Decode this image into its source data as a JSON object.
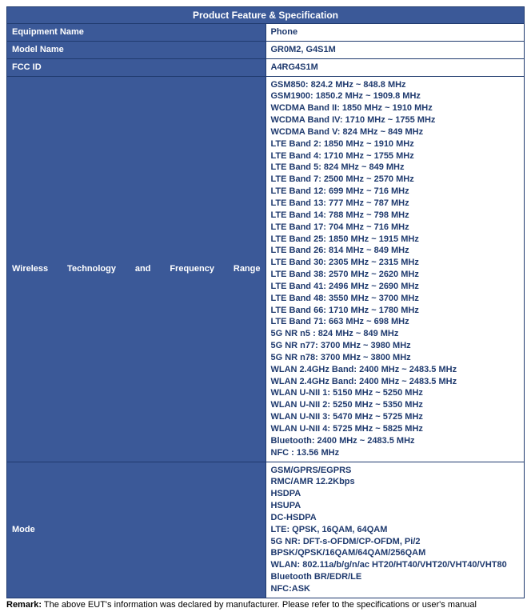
{
  "header": "Product Feature & Specification",
  "rows": {
    "equipment_name": {
      "label": "Equipment Name",
      "value": "Phone"
    },
    "model_name": {
      "label": "Model Name",
      "value": "GR0M2, G4S1M"
    },
    "fcc_id": {
      "label": "FCC ID",
      "value": "A4RG4S1M"
    },
    "wireless": {
      "label": "Wireless Technology and Frequency Range",
      "lines": [
        "GSM850: 824.2 MHz ~ 848.8 MHz",
        "GSM1900: 1850.2 MHz ~ 1909.8 MHz",
        "WCDMA Band II: 1850 MHz ~ 1910 MHz",
        "WCDMA Band IV: 1710 MHz ~ 1755 MHz",
        "WCDMA Band V: 824 MHz ~ 849 MHz",
        "LTE Band 2: 1850 MHz ~ 1910 MHz",
        "LTE Band 4: 1710 MHz ~ 1755 MHz",
        "LTE Band 5: 824 MHz ~ 849 MHz",
        "LTE Band 7: 2500 MHz ~ 2570 MHz",
        "LTE Band 12: 699 MHz ~ 716 MHz",
        "LTE Band 13: 777 MHz ~ 787 MHz",
        "LTE Band 14: 788 MHz ~ 798 MHz",
        "LTE Band 17: 704 MHz ~ 716 MHz",
        "LTE Band 25: 1850 MHz ~ 1915 MHz",
        "LTE Band 26: 814 MHz ~ 849 MHz",
        "LTE Band 30: 2305 MHz ~ 2315 MHz",
        "LTE Band 38: 2570 MHz ~ 2620 MHz",
        "LTE Band 41: 2496 MHz ~ 2690 MHz",
        "LTE Band 48: 3550 MHz ~ 3700 MHz",
        "LTE Band 66: 1710 MHz ~ 1780 MHz",
        "LTE Band 71: 663 MHz ~ 698 MHz",
        "5G NR n5 : 824 MHz ~ 849 MHz",
        "5G NR n77: 3700 MHz ~ 3980 MHz",
        "5G NR n78: 3700 MHz ~ 3800 MHz",
        "WLAN 2.4GHz Band: 2400 MHz ~ 2483.5 MHz",
        "WLAN 2.4GHz Band: 2400 MHz ~ 2483.5 MHz",
        "WLAN U-NII 1: 5150 MHz ~ 5250 MHz",
        "WLAN U-NII 2: 5250 MHz ~ 5350 MHz",
        "WLAN U-NII 3: 5470 MHz ~ 5725 MHz",
        "WLAN U-NII 4: 5725 MHz ~ 5825 MHz",
        "Bluetooth: 2400 MHz ~ 2483.5 MHz",
        "NFC : 13.56 MHz"
      ]
    },
    "mode": {
      "label": "Mode",
      "lines": [
        "GSM/GPRS/EGPRS",
        "RMC/AMR 12.2Kbps",
        "HSDPA",
        "HSUPA",
        "DC-HSDPA",
        "LTE: QPSK, 16QAM, 64QAM",
        "5G NR: DFT-s-OFDM/CP-OFDM, Pi/2 BPSK/QPSK/16QAM/64QAM/256QAM",
        "WLAN: 802.11a/b/g/n/ac HT20/HT40/VHT20/VHT40/VHT80",
        "Bluetooth BR/EDR/LE",
        "NFC:ASK"
      ]
    }
  },
  "remark": {
    "label": "Remark:",
    "text": " The above EUT's information was declared by manufacturer. Please refer to the specifications or user's manual"
  }
}
